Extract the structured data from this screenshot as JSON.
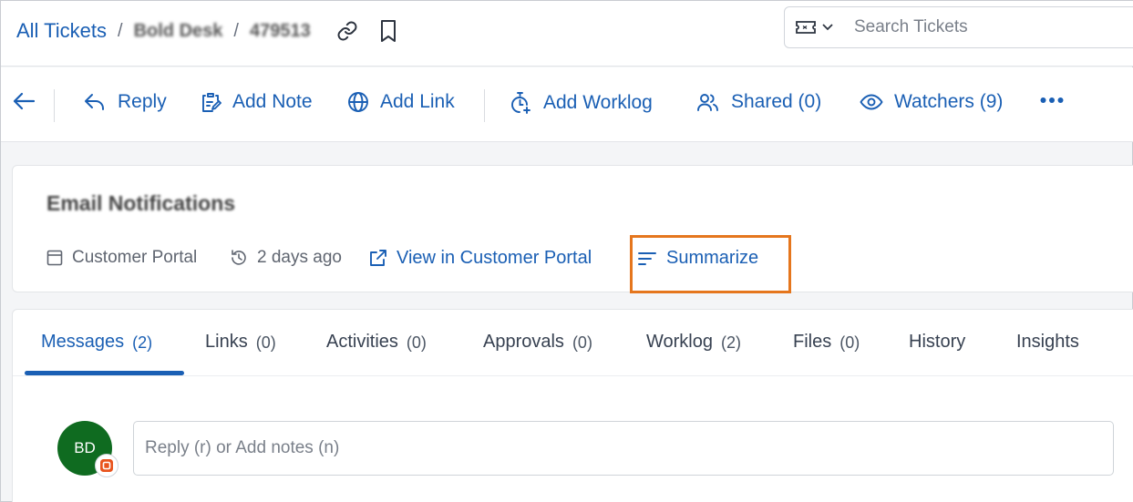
{
  "breadcrumb": {
    "root": "All Tickets",
    "separator": "/",
    "brand": "Bold Desk",
    "ticket_id": "479513"
  },
  "search": {
    "placeholder": "Search Tickets",
    "type_icon": "ticket-icon"
  },
  "actions": [
    {
      "label": "Reply",
      "icon": "reply-icon"
    },
    {
      "label": "Add Note",
      "icon": "note-icon"
    },
    {
      "label": "Add Link",
      "icon": "globe-icon"
    },
    {
      "label": "Add Worklog",
      "icon": "stopwatch-icon"
    },
    {
      "label": "Shared (0)",
      "icon": "users-icon"
    },
    {
      "label": "Watchers (9)",
      "icon": "eye-icon"
    }
  ],
  "ticket": {
    "title": "Email Notifications",
    "source": "Customer Portal",
    "age": "2 days ago",
    "view_portal_label": "View in Customer Portal",
    "summarize_label": "Summarize"
  },
  "tabs": [
    {
      "label": "Messages",
      "count": "(2)"
    },
    {
      "label": "Links",
      "count": "(0)"
    },
    {
      "label": "Activities",
      "count": "(0)"
    },
    {
      "label": "Approvals",
      "count": "(0)"
    },
    {
      "label": "Worklog",
      "count": "(2)"
    },
    {
      "label": "Files",
      "count": "(0)"
    },
    {
      "label": "History",
      "count": ""
    },
    {
      "label": "Insights",
      "count": ""
    }
  ],
  "composer": {
    "avatar_initials": "BD",
    "placeholder": "Reply (r) or Add notes (n)"
  },
  "colors": {
    "accent": "#1a5fb4",
    "highlight": "#e5761d",
    "avatar_bg": "#0f6b20"
  }
}
